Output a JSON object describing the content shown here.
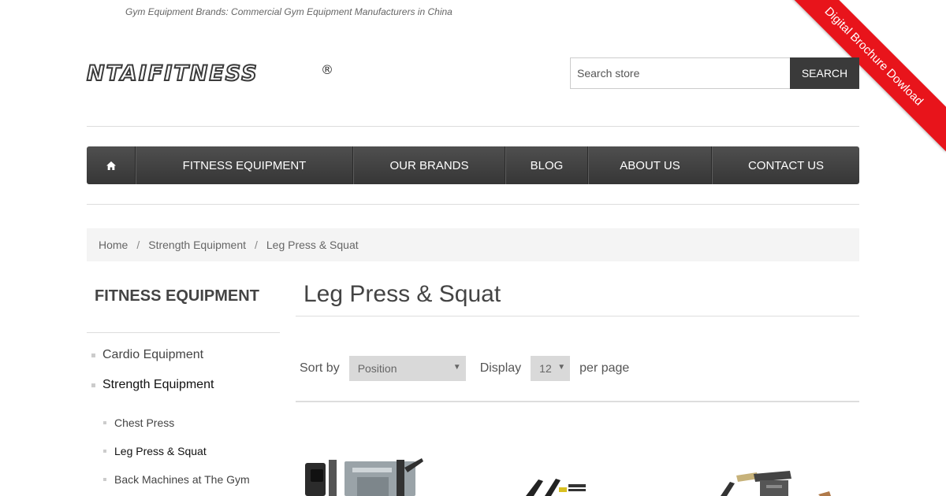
{
  "tagline": "Gym Equipment Brands: Commercial Gym Equipment Manufacturers in China",
  "ribbon": {
    "label": "Digital Brochure Dowload",
    "color": "#e8141b"
  },
  "logo": {
    "text": "NTAIFITNESS",
    "mark": "®"
  },
  "search": {
    "placeholder": "Search store",
    "button_label": "SEARCH"
  },
  "nav": {
    "home_icon": "home-icon",
    "items": [
      {
        "label": "FITNESS EQUIPMENT"
      },
      {
        "label": "OUR BRANDS"
      },
      {
        "label": "BLOG"
      },
      {
        "label": "ABOUT US"
      },
      {
        "label": "CONTACT US"
      }
    ]
  },
  "breadcrumb": {
    "items": [
      "Home",
      "Strength Equipment",
      "Leg Press & Squat"
    ],
    "separator": "/"
  },
  "sidebar": {
    "title": "FITNESS EQUIPMENT",
    "categories": [
      {
        "label": "Cardio Equipment"
      },
      {
        "label": "Strength Equipment"
      }
    ],
    "subcategories": [
      {
        "label": "Chest Press"
      },
      {
        "label": "Leg Press & Squat"
      },
      {
        "label": "Back Machines at The Gym"
      }
    ]
  },
  "main": {
    "title": "Leg Press & Squat",
    "sort_label": "Sort by",
    "sort_value": "Position",
    "display_label": "Display",
    "display_value": "12",
    "per_page_label": "per page"
  },
  "colors": {
    "nav_bg": "#3a3a3a",
    "accent": "#e8141b",
    "text": "#444444"
  }
}
